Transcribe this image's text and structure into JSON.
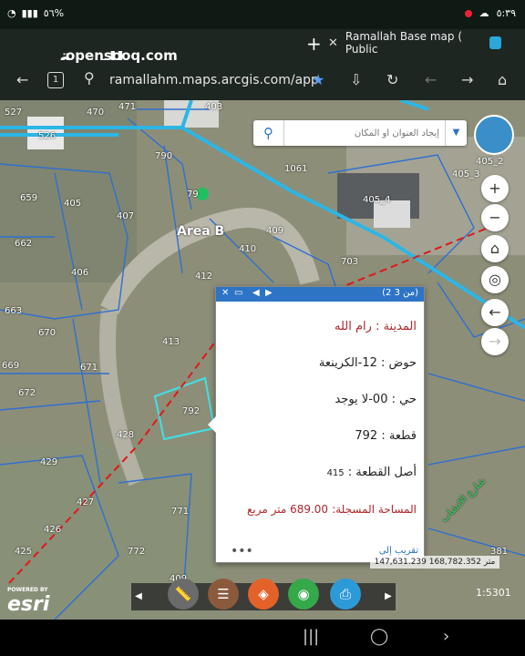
{
  "status": {
    "time": "٥:٣٩",
    "battery": "%٥٦"
  },
  "browser": {
    "tab_title": "Ramallah Base map ( Public",
    "tab_close": "✕",
    "new_tab": "+",
    "url": "ramallahm.maps.arcgis.com/app",
    "tab_count": "1"
  },
  "brand": {
    "name": "السوق المفتوح",
    "site": "opensooq.com"
  },
  "search": {
    "placeholder": "إيجاد العنوان أو المكان"
  },
  "map": {
    "area_label": "Area B",
    "parcel_labels": [
      "527",
      "470",
      "471",
      "403",
      "526",
      "790",
      "659",
      "405",
      "407",
      "79",
      "1061",
      "405_3",
      "405_2",
      "405_4",
      "662",
      "410",
      "409",
      "406",
      "412",
      "703",
      "663",
      "670",
      "669",
      "413",
      "671",
      "672",
      "792",
      "428",
      "429",
      "427",
      "426",
      "425",
      "771",
      "772",
      "409",
      "381"
    ],
    "road_label": "شارع الاتشاب"
  },
  "popup": {
    "counter": "(2 من 3)",
    "rows": [
      {
        "label": "المدينة :",
        "value": "رام الله"
      },
      {
        "label": "حوض :",
        "value": "12-الكرينعة"
      },
      {
        "label": "حي :",
        "value": "00-لا يوجد"
      },
      {
        "label": "قطعة :",
        "value": "792"
      },
      {
        "label": "أصل القطعة :",
        "value": "415"
      },
      {
        "label": "المساحة المسجلة:",
        "value": "689.00 متر مربع"
      }
    ],
    "zoom_link": "تقريب إلى",
    "more": "•••"
  },
  "scale_text": "147,631.239 168,782.352 متر",
  "esri": {
    "powered": "POWERED BY",
    "name": "esri"
  },
  "corner_label": "1:5301"
}
